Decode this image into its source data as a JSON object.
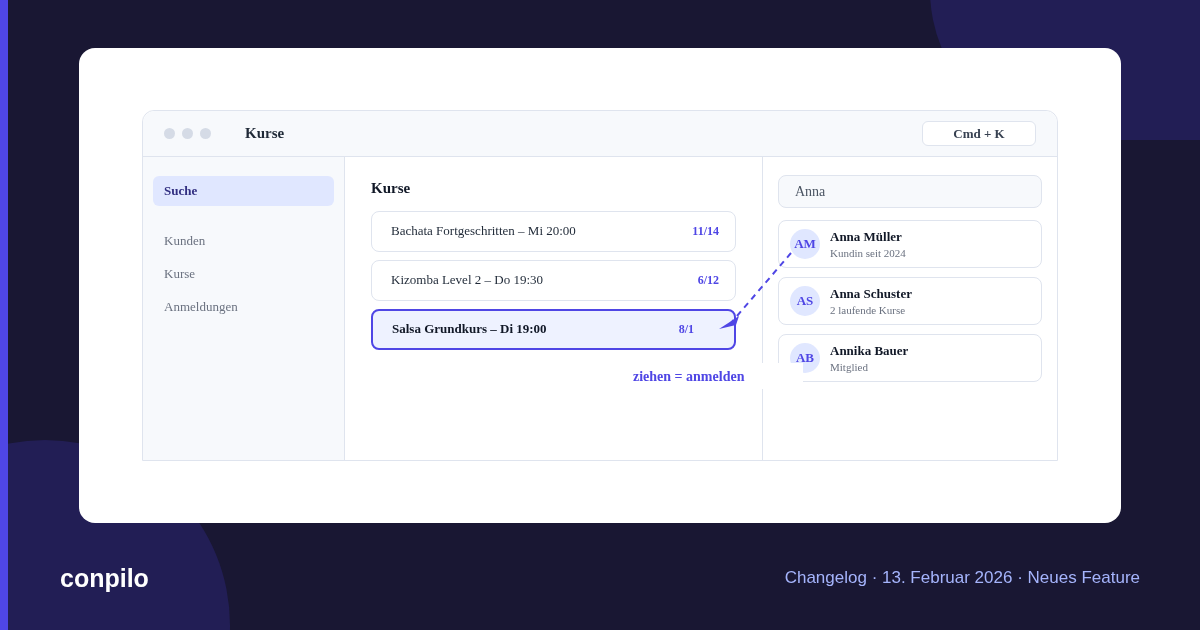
{
  "window": {
    "title": "Kurse",
    "shortcut": "Cmd + K"
  },
  "sidebar": {
    "items": [
      {
        "label": "Suche",
        "selected": true
      },
      {
        "label": "Kunden",
        "selected": false
      },
      {
        "label": "Kurse",
        "selected": false
      },
      {
        "label": "Anmeldungen",
        "selected": false
      }
    ]
  },
  "courses": {
    "heading": "Kurse",
    "items": [
      {
        "name": "Bachata Fortgeschritten – Mi 20:00",
        "count": "11/14",
        "selected": false
      },
      {
        "name": "Kizomba Level 2 – Do 19:30",
        "count": "6/12",
        "selected": false
      },
      {
        "name": "Salsa Grundkurs – Di 19:00",
        "count": "8/1",
        "selected": true
      }
    ]
  },
  "search": {
    "value": "Anna"
  },
  "results": [
    {
      "initials": "AM",
      "name": "Anna Müller",
      "detail": "Kundin seit 2024"
    },
    {
      "initials": "AS",
      "name": "Anna Schuster",
      "detail": "2 laufende Kurse"
    },
    {
      "initials": "AB",
      "name": "Annika Bauer",
      "detail": "Mitglied"
    }
  ],
  "drag_hint": "ziehen = anmelden",
  "footer": {
    "brand": "conpilo",
    "caption": "Changelog · 13. Februar 2026 · Neues Feature"
  }
}
